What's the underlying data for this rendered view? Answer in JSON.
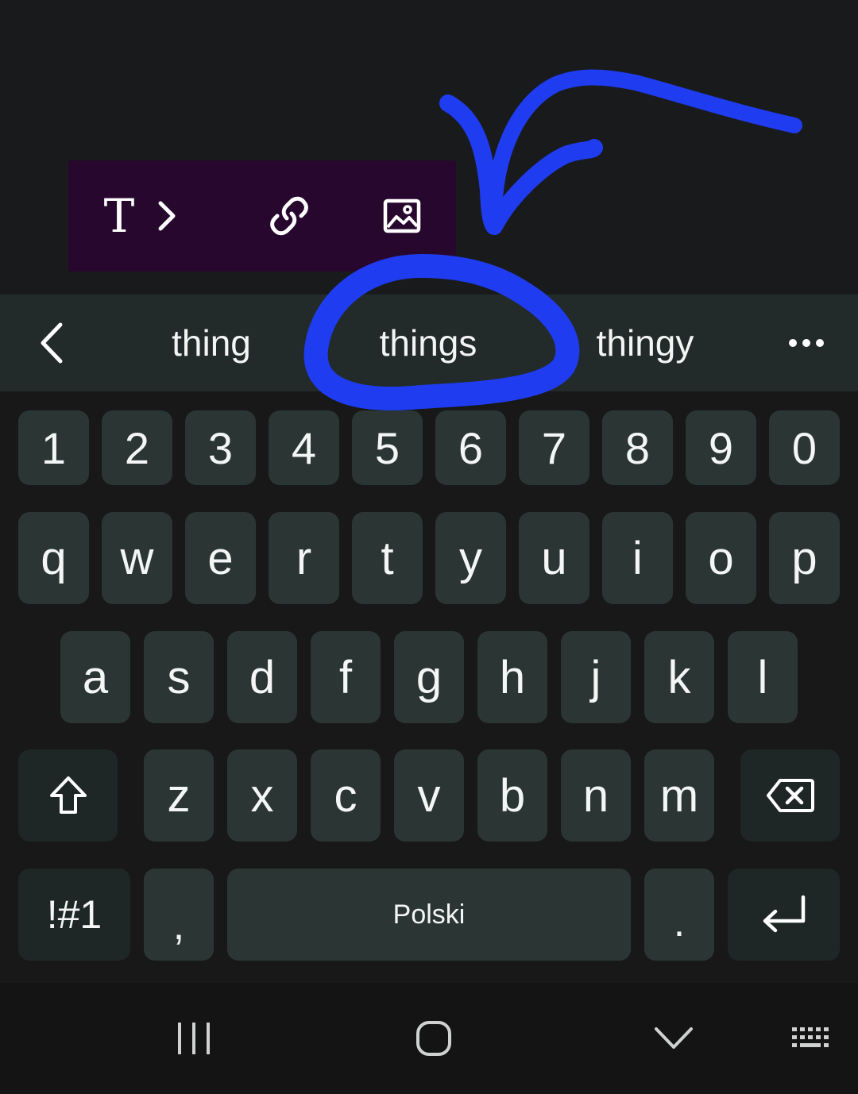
{
  "toolbar": {
    "buttons": [
      {
        "name": "text-format-icon",
        "glyph": "T"
      },
      {
        "name": "chevron-right-icon"
      },
      {
        "name": "link-icon"
      },
      {
        "name": "image-icon"
      }
    ]
  },
  "suggestions": {
    "items": [
      "thing",
      "things",
      "thingy"
    ],
    "back_icon": "chevron-left-icon",
    "more_icon": "more-horizontal-icon"
  },
  "keyboard": {
    "number_row": [
      "1",
      "2",
      "3",
      "4",
      "5",
      "6",
      "7",
      "8",
      "9",
      "0"
    ],
    "row1": [
      "q",
      "w",
      "e",
      "r",
      "t",
      "y",
      "u",
      "i",
      "o",
      "p"
    ],
    "row2": [
      "a",
      "s",
      "d",
      "f",
      "g",
      "h",
      "j",
      "k",
      "l"
    ],
    "row3": [
      "z",
      "x",
      "c",
      "v",
      "b",
      "n",
      "m"
    ],
    "symbols_label": "!#1",
    "comma_label": ",",
    "space_label": "Polski",
    "period_label": ".",
    "shift_icon": "shift-icon",
    "backspace_icon": "backspace-icon",
    "enter_icon": "enter-icon"
  },
  "navbar": {
    "icons": [
      "recents-icon",
      "home-icon",
      "hide-keyboard-icon",
      "keyboard-switch-icon"
    ]
  },
  "colors": {
    "background": "#191a1c",
    "toolbar": "#28072f",
    "suggestion_strip": "#222b29",
    "key": "#2b3634",
    "function_key": "#1e2725",
    "annotation": "#1f3cf0"
  }
}
